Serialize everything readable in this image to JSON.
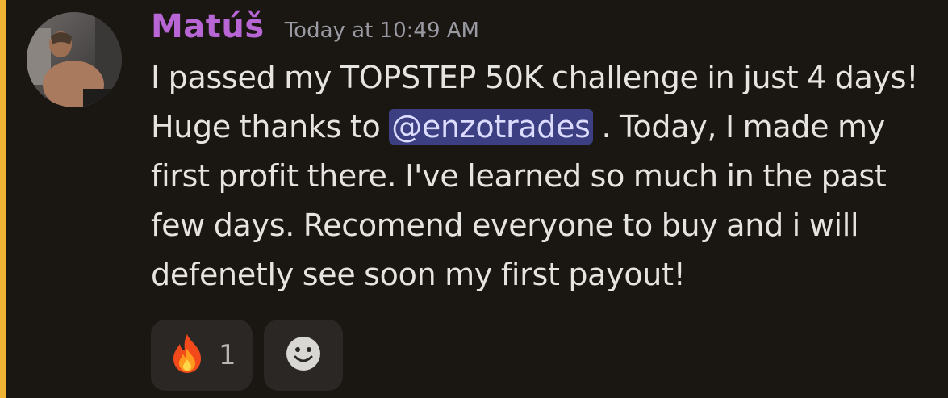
{
  "message": {
    "author": "Matúš",
    "timestamp": "Today at 10:49 AM",
    "text_before_mention": "I passed my TOPSTEP 50K challenge in just 4 days! Huge thanks to ",
    "mention": "@enzotrades",
    "text_after_mention": " . Today, I made my first profit there. I've learned so much in the past few days. Recomend everyone to buy and i will defenetly see soon my first payout!"
  },
  "reactions": [
    {
      "emoji": "fire-icon",
      "count": "1"
    }
  ],
  "add_reaction": {
    "icon": "smiley-add-reaction-icon"
  },
  "colors": {
    "background": "#1a1612",
    "highlight_bar": "#f0b232",
    "username": "#b866d6",
    "mention_bg": "#3c3f82"
  }
}
